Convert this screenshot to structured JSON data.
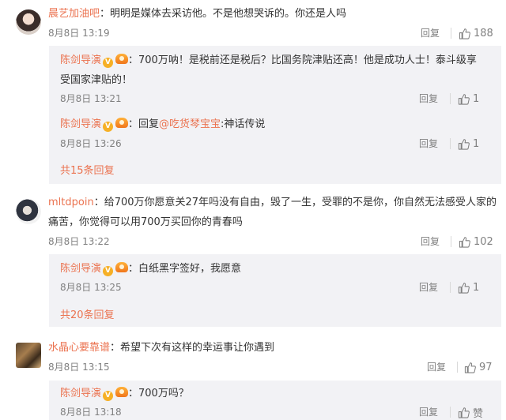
{
  "comments": [
    {
      "username": "晨艺加油吧",
      "text": "：明明是媒体去采访他。不是他想哭诉的。你还是人吗",
      "time": "8月8日 13:19",
      "reply_label": "回复",
      "likes": "188"
    },
    {
      "username": "mltdpoin",
      "text_line1": "：给700万你愿意关27年吗没有自由，毁了一生，受罪的不是你，你自然无法感受人家的",
      "text_line2": "痛苦，你觉得可以用700万买回你的青春吗",
      "time": "8月8日 13:22",
      "reply_label": "回复",
      "likes": "102"
    },
    {
      "username": "水晶心要靠谱",
      "text": "：希望下次有这样的幸运事让你遇到",
      "time": "8月8日 13:15",
      "reply_label": "回复",
      "likes": "97"
    }
  ],
  "replies": [
    {
      "username": "陈剑导演",
      "text_line1": "：700万呐！是税前还是税后？比国务院津贴还高！他是成功人士！泰斗级享",
      "text_line2": "受国家津贴的！",
      "time": "8月8日 13:21",
      "reply_label": "回复",
      "likes": "1"
    },
    {
      "username": "陈剑导演",
      "prefix": "：回复",
      "mention": "@吃货琴宝宝",
      "suffix": ":神话传说",
      "time": "8月8日 13:26",
      "reply_label": "回复",
      "likes": "1"
    },
    {
      "username": "陈剑导演",
      "text": "：白纸黑字签好，我愿意",
      "time": "8月8日 13:25",
      "reply_label": "回复",
      "likes": "1"
    },
    {
      "username": "陈剑导演",
      "text": "：700万吗？",
      "time": "8月8日 13:18",
      "reply_label": "回复",
      "likes": "赞"
    }
  ],
  "more_links": [
    "共15条回复",
    "共20条回复"
  ],
  "badge_v": "V",
  "colors": {
    "accent": "#eb7350",
    "reply_bg": "#f2f2f5",
    "muted": "#808080"
  },
  "icons": {
    "like": "thumbs-up-icon",
    "verified": "verified-v-icon",
    "medal": "medal-icon"
  }
}
